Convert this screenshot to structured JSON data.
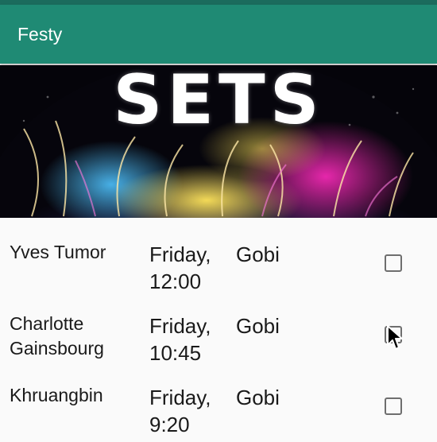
{
  "app": {
    "title": "Festy"
  },
  "hero": {
    "title": "SETS"
  },
  "sets": [
    {
      "artist": "Yves Tumor",
      "day": "Friday,",
      "time": "12:00",
      "stage": "Gobi",
      "checked": false
    },
    {
      "artist_line1": "Charlotte",
      "artist_line2": "Gainsbourg",
      "day": "Friday,",
      "time": "10:45",
      "stage": "Gobi",
      "checked": false
    },
    {
      "artist": "Khruangbin",
      "day": "Friday,",
      "time": "9:20",
      "stage": "Gobi",
      "checked": false
    }
  ],
  "colors": {
    "appbar": "#1f8a74",
    "statusbar": "#1b6b5d",
    "background": "#fafafa",
    "text": "#1a1a1a"
  }
}
